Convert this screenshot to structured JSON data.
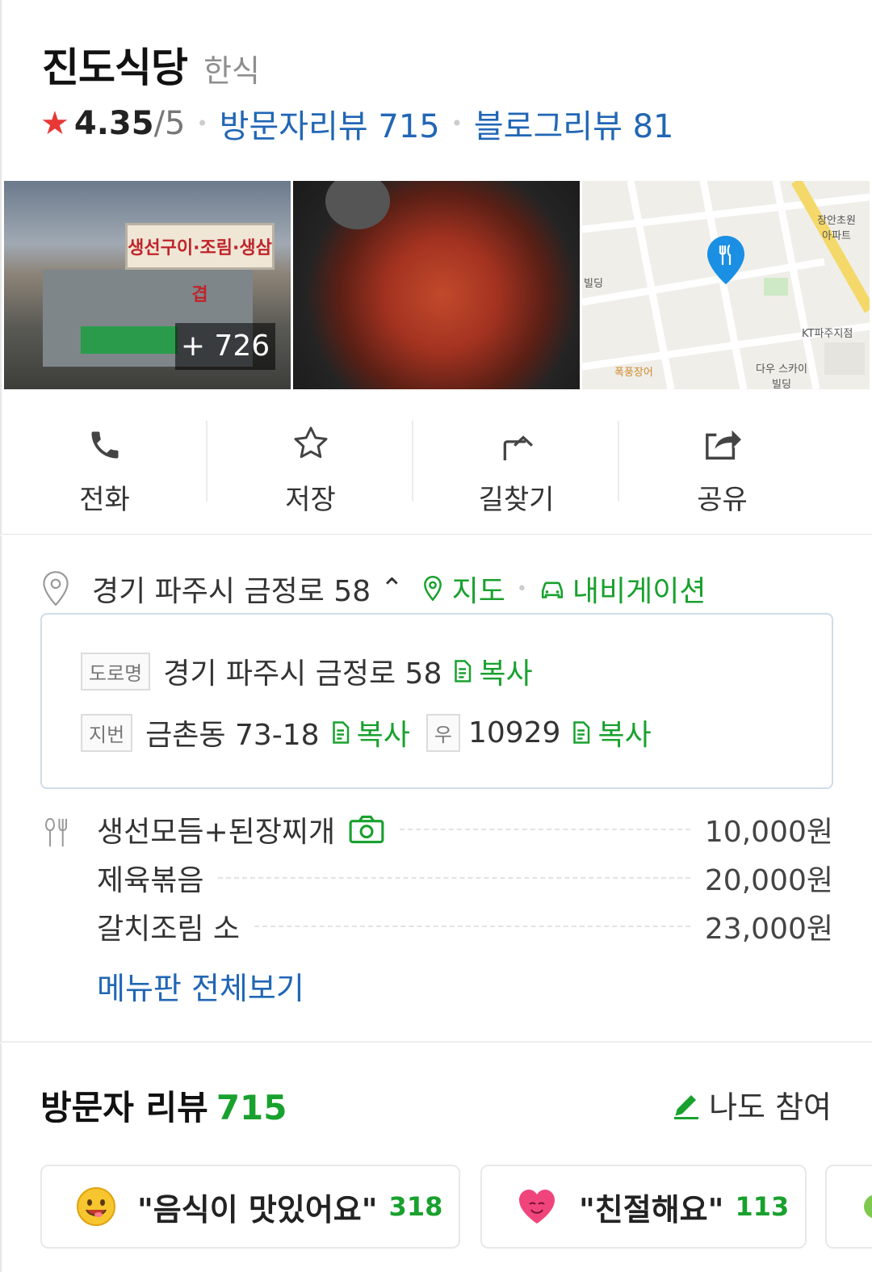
{
  "place": {
    "name": "진도식당",
    "category": "한식",
    "rating": "4.35",
    "rating_max": "/5",
    "visitor_reviews_label": "방문자리뷰 715",
    "blog_reviews_label": "블로그리뷰 81"
  },
  "photos": {
    "more_count": "+ 726",
    "storefront_sign": "생선구이·조림·생삼겹"
  },
  "map_labels": {
    "apartment": "장안초원 아파트",
    "kt": "KT파주지점",
    "daewoo": "다우 스카이빌딩",
    "restaurant": "폭풍장어",
    "building": "빌딩"
  },
  "actions": [
    {
      "label": "전화",
      "icon": "phone-icon"
    },
    {
      "label": "저장",
      "icon": "star-outline-icon"
    },
    {
      "label": "길찾기",
      "icon": "directions-icon"
    },
    {
      "label": "공유",
      "icon": "share-icon"
    }
  ],
  "address": {
    "main": "경기 파주시 금정로 58",
    "map_link": "지도",
    "nav_link": "내비게이션",
    "road_tag": "도로명",
    "road_addr": "경기 파주시 금정로 58",
    "lot_tag": "지번",
    "lot_addr": "금촌동 73-18",
    "zip_tag": "우",
    "zip": "10929",
    "copy_label": "복사"
  },
  "menu": {
    "items": [
      {
        "name": "생선모듬+된장찌개",
        "price": "10,000원"
      },
      {
        "name": "제육볶음",
        "price": "20,000원"
      },
      {
        "name": "갈치조림 소",
        "price": "23,000원"
      }
    ],
    "see_all": "메뉴판 전체보기"
  },
  "reviews": {
    "title": "방문자 리뷰",
    "count": "715",
    "join_label": "나도 참여",
    "chips": [
      {
        "text": "\"음식이 맛있어요\"",
        "count": "318"
      },
      {
        "text": "\"친절해요\"",
        "count": "113"
      }
    ]
  },
  "colors": {
    "accent_green": "#19a12e",
    "link_blue": "#2166b5",
    "star_red": "#e73836"
  }
}
